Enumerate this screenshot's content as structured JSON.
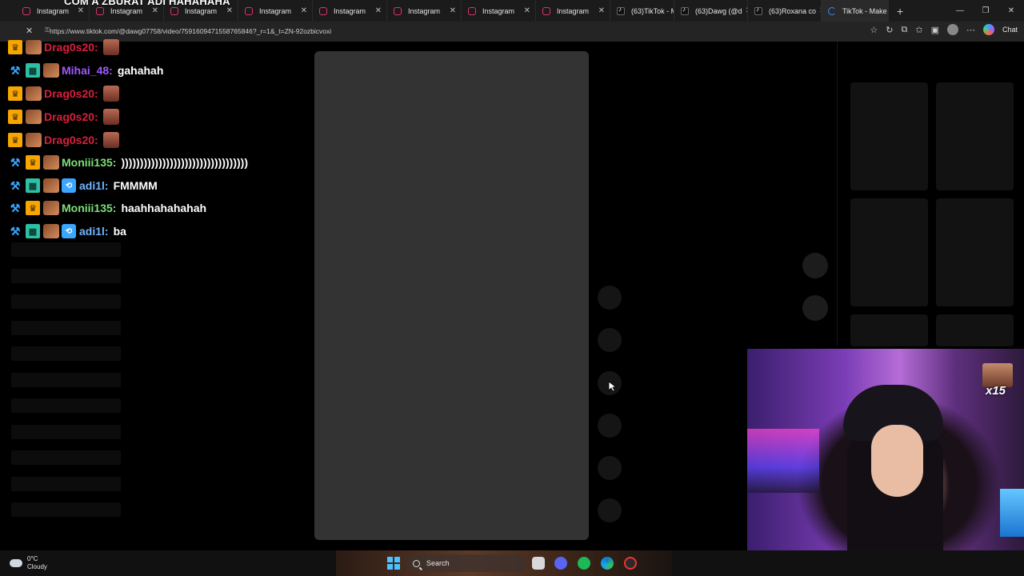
{
  "stream_title": {
    "prefix": "",
    "text": "COM A ZBURAT ADI HAHAHAHA"
  },
  "browser": {
    "tabs": [
      {
        "label": "Instagram",
        "icon": "instagram-icon"
      },
      {
        "label": "Instagram",
        "icon": "instagram-icon"
      },
      {
        "label": "Instagram",
        "icon": "instagram-icon"
      },
      {
        "label": "Instagram",
        "icon": "instagram-icon"
      },
      {
        "label": "Instagram",
        "icon": "instagram-icon"
      },
      {
        "label": "Instagram",
        "icon": "instagram-icon"
      },
      {
        "label": "Instagram",
        "icon": "instagram-icon"
      },
      {
        "label": "Instagram",
        "icon": "instagram-icon"
      },
      {
        "label": "(63)TikTok - M",
        "icon": "tiktok-icon"
      },
      {
        "label": "(63)Dawg (@d",
        "icon": "tiktok-icon"
      },
      {
        "label": "(63)Roxana co",
        "icon": "tiktok-icon"
      },
      {
        "label": "TikTok - Make",
        "icon": "loading-icon",
        "active": true
      }
    ],
    "url": "https://www.tiktok.com/@dawg07758/video/7591609471558765846?_r=1&_t=ZN-92ozbicvoxi",
    "chat_label": "Chat"
  },
  "chat": {
    "messages": [
      {
        "user": "Drag0s20:",
        "text": "",
        "color": "#d9203c",
        "badges": [
          "crown"
        ],
        "face": true
      },
      {
        "user": "Mihai_48:",
        "text": "gahahah",
        "color": "#a257ff",
        "badges": [
          "mod",
          "grid"
        ],
        "face": false
      },
      {
        "user": "Drag0s20:",
        "text": "",
        "color": "#d9203c",
        "badges": [
          "crown"
        ],
        "face": true
      },
      {
        "user": "Drag0s20:",
        "text": "",
        "color": "#d9203c",
        "badges": [
          "crown"
        ],
        "face": true
      },
      {
        "user": "Drag0s20:",
        "text": "",
        "color": "#d9203c",
        "badges": [
          "crown"
        ],
        "face": true
      },
      {
        "user": "Moniii135:",
        "text": "))))))))))))))))))))))))))))))))))",
        "color": "#7ee07a",
        "badges": [
          "mod",
          "crown"
        ],
        "face": false
      },
      {
        "user": "adi1l:",
        "text": "FMMMM",
        "color": "#6fb6ff",
        "badges": [
          "mod",
          "grid",
          "tt"
        ],
        "face": false
      },
      {
        "user": "Moniii135:",
        "text": "haahhahahahah",
        "color": "#7ee07a",
        "badges": [
          "mod",
          "crown"
        ],
        "face": false
      },
      {
        "user": "adi1l:",
        "text": "ba",
        "color": "#6fb6ff",
        "badges": [
          "mod",
          "grid",
          "tt"
        ],
        "face": false
      }
    ]
  },
  "overlay": {
    "multiplier": "x15"
  },
  "taskbar": {
    "weather": {
      "temp": "0°C",
      "condition": "Cloudy"
    },
    "search_label": "Search"
  },
  "colors": {
    "video_panel": "#333333",
    "background": "#000000",
    "accent": "#3aa6ff"
  }
}
